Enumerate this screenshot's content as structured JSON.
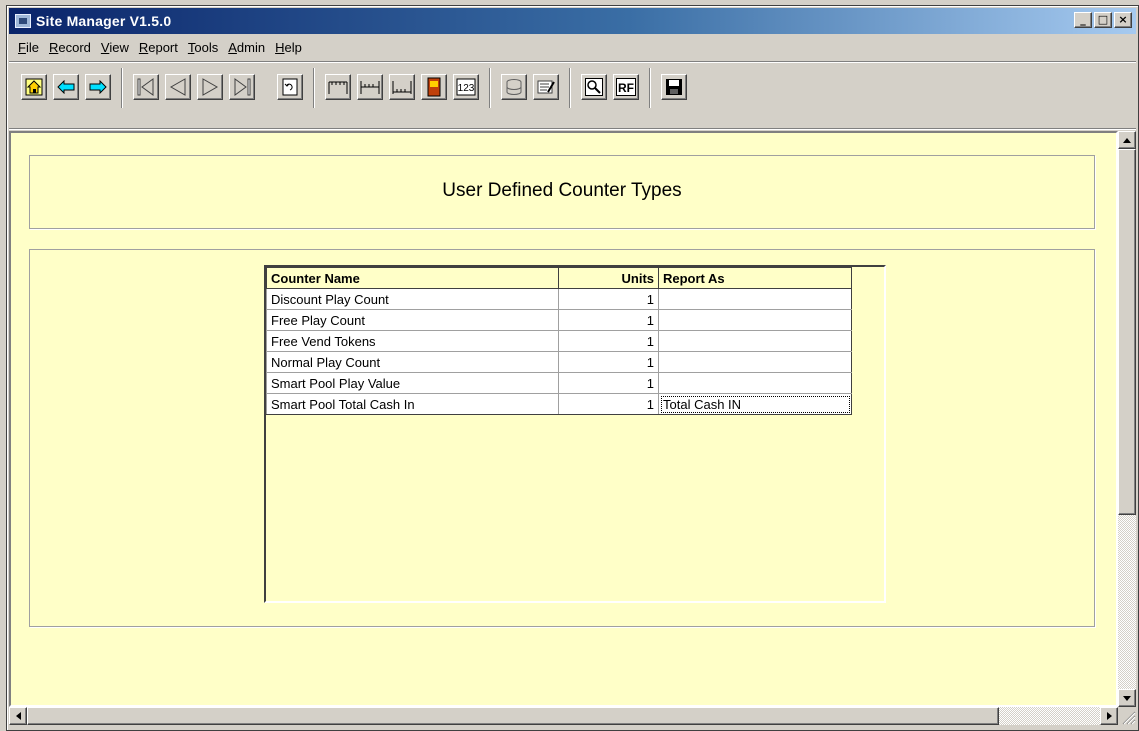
{
  "window": {
    "title": "Site Manager  V1.5.0",
    "controls": {
      "minimize": "_",
      "maximize": "□",
      "close": "×"
    }
  },
  "menu": [
    {
      "label": "File",
      "mnemonic": "F",
      "rest": "ile"
    },
    {
      "label": "Record",
      "mnemonic": "R",
      "rest": "ecord"
    },
    {
      "label": "View",
      "mnemonic": "V",
      "rest": "iew"
    },
    {
      "label": "Report",
      "mnemonic": "R",
      "rest": "eport"
    },
    {
      "label": "Tools",
      "mnemonic": "T",
      "rest": "ools"
    },
    {
      "label": "Admin",
      "mnemonic": "A",
      "rest": "dmin"
    },
    {
      "label": "Help",
      "mnemonic": "H",
      "rest": "elp"
    }
  ],
  "toolbar": {
    "icons": [
      "home-icon",
      "back-arrow-icon",
      "forward-arrow-icon",
      "first-record-icon",
      "previous-record-icon",
      "next-record-icon",
      "last-record-icon",
      "refresh-icon",
      "top-meter-icon",
      "mid-meter-icon",
      "bottom-meter-icon",
      "device-icon",
      "numeric-icon",
      "database-icon",
      "edit-icon",
      "search-icon",
      "rf-icon",
      "save-icon"
    ],
    "rf_label": "RF",
    "num_label": "123"
  },
  "header": {
    "title": "User Defined Counter Types"
  },
  "grid": {
    "columns": [
      "Counter Name",
      "Units",
      "Report As"
    ],
    "rows": [
      {
        "name": "Discount Play Count",
        "units": "1",
        "report_as": ""
      },
      {
        "name": "Free Play Count",
        "units": "1",
        "report_as": ""
      },
      {
        "name": "Free Vend Tokens",
        "units": "1",
        "report_as": ""
      },
      {
        "name": "Normal Play Count",
        "units": "1",
        "report_as": ""
      },
      {
        "name": "Smart Pool Play Value",
        "units": "1",
        "report_as": ""
      },
      {
        "name": "Smart Pool Total Cash In",
        "units": "1",
        "report_as": "Total Cash IN"
      }
    ]
  },
  "colors": {
    "client_bg": "#ffffc8",
    "title_bar_start": "#0a246a",
    "title_bar_end": "#a6caf0",
    "chrome": "#d4d0c8"
  }
}
